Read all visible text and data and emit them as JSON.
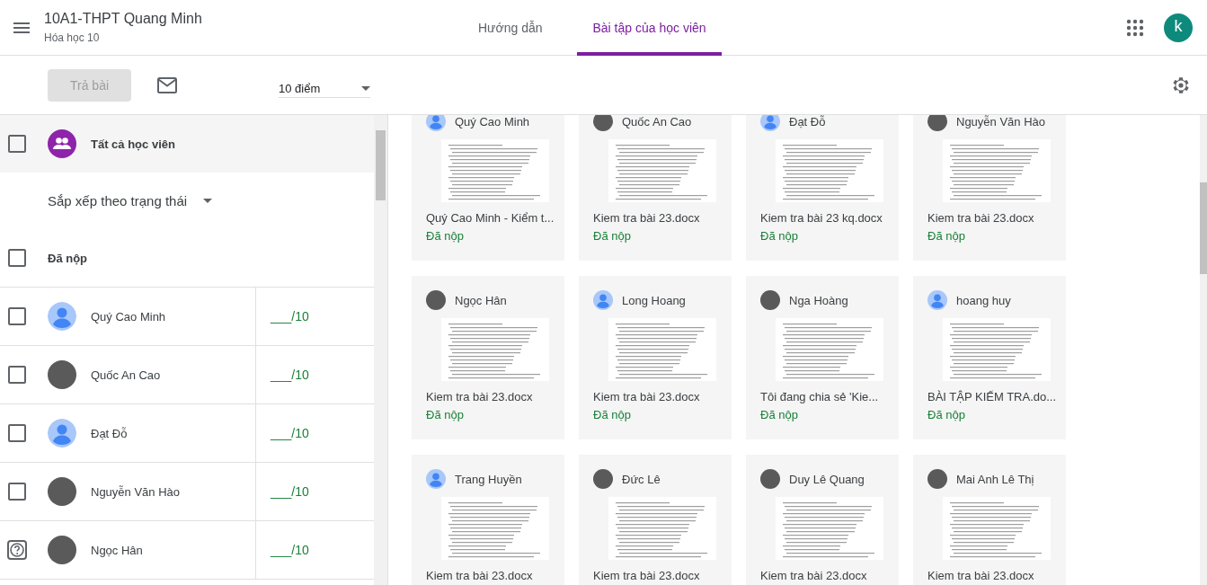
{
  "header": {
    "class_name": "10A1-THPT Quang Minh",
    "subject": "Hóa học 10",
    "account_initial": "k"
  },
  "tabs": [
    {
      "label": "Hướng dẫn",
      "selected": false
    },
    {
      "label": "Bài tập của học viên",
      "selected": true
    }
  ],
  "toolbar": {
    "return_button": {
      "label": "Trả bài",
      "disabled": true
    },
    "points": {
      "value": "10 điểm"
    }
  },
  "student_list": {
    "all_students": {
      "label": "Tất cả học viên",
      "checked": false
    },
    "sort": {
      "label": "Sắp xếp theo trạng thái"
    },
    "groups": [
      {
        "label": "Đã nộp",
        "checked": false,
        "students": [
          {
            "name": "Quý Cao Minh",
            "avatar": {
              "kind": "default"
            },
            "checked": false,
            "grade": "___/10"
          },
          {
            "name": "Quốc An Cao",
            "avatar": {
              "kind": "photo"
            },
            "checked": false,
            "grade": "___/10"
          },
          {
            "name": "Đạt Đỗ",
            "avatar": {
              "kind": "default"
            },
            "checked": false,
            "grade": "___/10"
          },
          {
            "name": "Nguyễn Văn Hào",
            "avatar": {
              "kind": "photo"
            },
            "checked": false,
            "grade": "___/10"
          },
          {
            "name": "Ngọc Hân",
            "avatar": {
              "kind": "photo"
            },
            "grade": "___/10"
          }
        ]
      }
    ]
  },
  "submissions": [
    {
      "name": "Quý Cao Minh",
      "avatar": {
        "kind": "default"
      },
      "file": "Quý Cao Minh - Kiểm t...",
      "status": "Đã nộp"
    },
    {
      "name": "Quốc An Cao",
      "avatar": {
        "kind": "photo"
      },
      "file": "Kiem tra bài 23.docx",
      "status": "Đã nộp"
    },
    {
      "name": "Đạt Đỗ",
      "avatar": {
        "kind": "default"
      },
      "file": "Kiem tra bài 23 kq.docx",
      "status": "Đã nộp"
    },
    {
      "name": "Nguyễn Văn Hào",
      "avatar": {
        "kind": "photo"
      },
      "file": "Kiem tra bài 23.docx",
      "status": "Đã nộp"
    },
    {
      "name": "Ngọc Hân",
      "avatar": {
        "kind": "photo"
      },
      "file": "Kiem tra bài 23.docx",
      "status": "Đã nộp"
    },
    {
      "name": "Long Hoang",
      "avatar": {
        "kind": "default"
      },
      "file": "Kiem tra bài 23.docx",
      "status": "Đã nộp"
    },
    {
      "name": "Nga Hoàng",
      "avatar": {
        "kind": "photo"
      },
      "file": "Tôi đang chia sẻ 'Kie...",
      "status": "Đã nộp"
    },
    {
      "name": "hoang huy",
      "avatar": {
        "kind": "default"
      },
      "file": "BÀI TẬP KIẾM TRA.do...",
      "status": "Đã nộp"
    },
    {
      "name": "Trang Huyền",
      "avatar": {
        "kind": "default"
      },
      "file": "Kiem tra bài 23.docx"
    },
    {
      "name": "Đức Lê",
      "avatar": {
        "kind": "photo"
      },
      "file": "Kiem tra bài 23.docx"
    },
    {
      "name": "Duy Lê Quang",
      "avatar": {
        "kind": "photo"
      },
      "file": "Kiem tra bài 23.docx"
    },
    {
      "name": "Mai Anh Lê Thị",
      "avatar": {
        "kind": "photo"
      },
      "file": "Kiem tra bài 23.docx"
    }
  ]
}
